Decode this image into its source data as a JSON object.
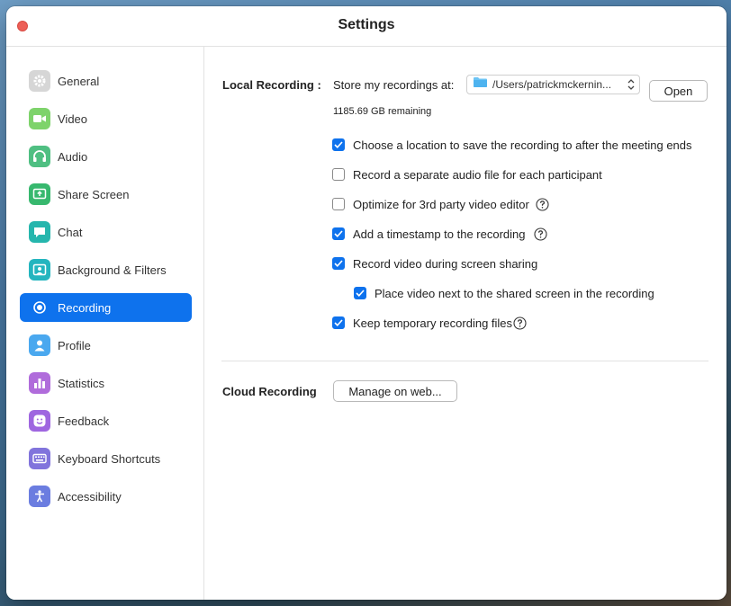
{
  "window": {
    "title": "Settings"
  },
  "sidebar": {
    "items": [
      {
        "label": "General",
        "icon": "gear-icon",
        "color": "#d6d6d6",
        "active": false
      },
      {
        "label": "Video",
        "icon": "video-camera-icon",
        "color": "#7ed36b",
        "active": false
      },
      {
        "label": "Audio",
        "icon": "headphones-icon",
        "color": "#4fbf82",
        "active": false
      },
      {
        "label": "Share Screen",
        "icon": "share-screen-icon",
        "color": "#37b86e",
        "active": false
      },
      {
        "label": "Chat",
        "icon": "chat-bubble-icon",
        "color": "#26b6ad",
        "active": false
      },
      {
        "label": "Background & Filters",
        "icon": "background-person-icon",
        "color": "#24b5bf",
        "active": false
      },
      {
        "label": "Recording",
        "icon": "record-icon",
        "color": "#0e72ed",
        "active": true
      },
      {
        "label": "Profile",
        "icon": "person-icon",
        "color": "#4aa8ef",
        "active": false
      },
      {
        "label": "Statistics",
        "icon": "bar-chart-icon",
        "color": "#b06cdb",
        "active": false
      },
      {
        "label": "Feedback",
        "icon": "smiley-icon",
        "color": "#9f66e0",
        "active": false
      },
      {
        "label": "Keyboard Shortcuts",
        "icon": "keyboard-icon",
        "color": "#8174dc",
        "active": false
      },
      {
        "label": "Accessibility",
        "icon": "accessibility-icon",
        "color": "#6b7de0",
        "active": false
      }
    ]
  },
  "local_recording": {
    "label": "Local Recording :",
    "store_label": "Store my recordings at:",
    "path": "/Users/patrickmckernin...",
    "open_button": "Open",
    "remaining": "1185.69 GB remaining",
    "options": [
      {
        "label": "Choose a location to save the recording to after the meeting ends",
        "checked": true,
        "help": false
      },
      {
        "label": "Record a separate audio file for each participant",
        "checked": false,
        "help": false
      },
      {
        "label": "Optimize for 3rd party video editor",
        "checked": false,
        "help": true
      },
      {
        "label": "Add a timestamp to the recording",
        "checked": true,
        "help": true
      },
      {
        "label": "Record video during screen sharing",
        "checked": true,
        "help": false
      },
      {
        "label": "Place video next to the shared screen in the recording",
        "checked": true,
        "help": false,
        "indented": true
      },
      {
        "label": "Keep temporary recording files",
        "checked": true,
        "help": true
      }
    ]
  },
  "cloud_recording": {
    "label": "Cloud Recording",
    "manage_button": "Manage on web..."
  },
  "colors": {
    "accent": "#0e72ed",
    "close": "#ed5f57"
  }
}
